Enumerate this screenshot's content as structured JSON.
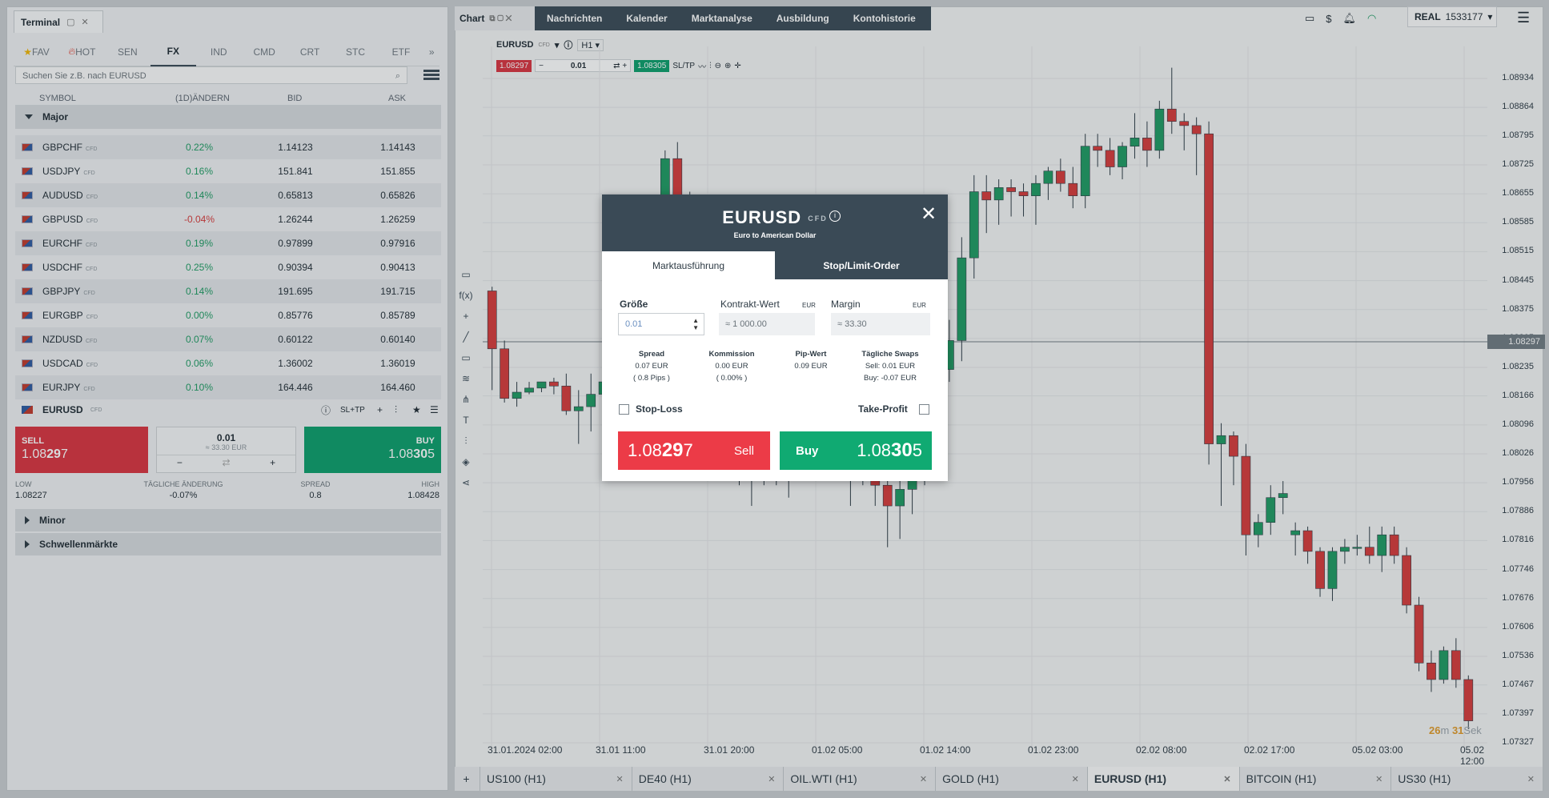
{
  "terminal": {
    "tab_label": "Terminal",
    "categories": [
      "FAV",
      "HOT",
      "SEN",
      "FX",
      "IND",
      "CMD",
      "CRT",
      "STC",
      "ETF"
    ],
    "search_placeholder": "Suchen Sie z.B. nach EURUSD",
    "columns": {
      "symbol": "SYMBOL",
      "change": "(1D)ÄNDERN",
      "bid": "BID",
      "ask": "ASK"
    },
    "group_major": "Major",
    "cfd_tag": "CFD",
    "rows": [
      {
        "symbol": "GBPCHF",
        "change": "0.22%",
        "bid": "1.14123",
        "ask": "1.14143",
        "dir": "pos"
      },
      {
        "symbol": "USDJPY",
        "change": "0.16%",
        "bid": "151.841",
        "ask": "151.855",
        "dir": "pos"
      },
      {
        "symbol": "AUDUSD",
        "change": "0.14%",
        "bid": "0.65813",
        "ask": "0.65826",
        "dir": "pos"
      },
      {
        "symbol": "GBPUSD",
        "change": "-0.04%",
        "bid": "1.26244",
        "ask": "1.26259",
        "dir": "neg"
      },
      {
        "symbol": "EURCHF",
        "change": "0.19%",
        "bid": "0.97899",
        "ask": "0.97916",
        "dir": "pos"
      },
      {
        "symbol": "USDCHF",
        "change": "0.25%",
        "bid": "0.90394",
        "ask": "0.90413",
        "dir": "pos"
      },
      {
        "symbol": "GBPJPY",
        "change": "0.14%",
        "bid": "191.695",
        "ask": "191.715",
        "dir": "pos"
      },
      {
        "symbol": "EURGBP",
        "change": "0.00%",
        "bid": "0.85776",
        "ask": "0.85789",
        "dir": "pos"
      },
      {
        "symbol": "NZDUSD",
        "change": "0.07%",
        "bid": "0.60122",
        "ask": "0.60140",
        "dir": "pos"
      },
      {
        "symbol": "USDCAD",
        "change": "0.06%",
        "bid": "1.36002",
        "ask": "1.36019",
        "dir": "pos"
      },
      {
        "symbol": "EURJPY",
        "change": "0.10%",
        "bid": "164.446",
        "ask": "164.460",
        "dir": "pos"
      }
    ],
    "selected": {
      "symbol": "EURUSD",
      "sltp": "SL+TP",
      "sell_label": "SELL",
      "sell_price_a": "1.08",
      "sell_price_b": "29",
      "sell_price_c": "7",
      "buy_label": "BUY",
      "buy_price_a": "1.08",
      "buy_price_b": "30",
      "buy_price_c": "5",
      "qty": "0.01",
      "qty_eur": "≈ 33.30 EUR",
      "low_label": "LOW",
      "low": "1.08227",
      "daily_label": "TÄGLICHE ÄNDERUNG",
      "daily": "-0.07%",
      "spread_label": "SPREAD",
      "spread": "0.8",
      "high_label": "HIGH",
      "high": "1.08428"
    },
    "group_minor": "Minor",
    "group_emerging": "Schwellenmärkte"
  },
  "nav": {
    "chart_tab": "Chart",
    "items": [
      "Nachrichten",
      "Kalender",
      "Marktanalyse",
      "Ausbildung",
      "Kontohistorie"
    ],
    "account_type": "REAL",
    "account_id": "1533177"
  },
  "chart_toolbar": {
    "symbol": "EURUSD",
    "cfd": "CFD",
    "timeframe": "H1",
    "sell_price": "1.08297",
    "qty": "0.01",
    "buy_price": "1.08305",
    "sltp": "SL/TP"
  },
  "chart_data": {
    "type": "candlestick",
    "symbol": "EURUSD",
    "timeframe": "H1",
    "y_ticks": [
      "1.08934",
      "1.08864",
      "1.08795",
      "1.08725",
      "1.08655",
      "1.08585",
      "1.08515",
      "1.08445",
      "1.08375",
      "1.08305",
      "1.08235",
      "1.08166",
      "1.08096",
      "1.08026",
      "1.07956",
      "1.07886",
      "1.07816",
      "1.07746",
      "1.07676",
      "1.07606",
      "1.07536",
      "1.07467",
      "1.07397",
      "1.07327"
    ],
    "ylim": [
      1.07327,
      1.08934
    ],
    "current_price": "1.08297",
    "x_ticks": [
      "31.01.2024 02:00",
      "31.01 11:00",
      "31.01 20:00",
      "01.02 05:00",
      "01.02 14:00",
      "01.02 23:00",
      "02.02 08:00",
      "02.02 17:00",
      "05.02 03:00",
      "05.02 12:00"
    ],
    "timer": {
      "m": "26",
      "m_unit": "m",
      "s": "31",
      "s_unit": "Sek"
    },
    "colors": {
      "up": "#1e9a62",
      "down": "#d63a3a"
    },
    "candles": [
      [
        1.0842,
        1.0843,
        1.0818,
        1.0828
      ],
      [
        1.0828,
        1.083,
        1.0815,
        1.0816
      ],
      [
        1.0816,
        1.082,
        1.0814,
        1.08175
      ],
      [
        1.08175,
        1.082,
        1.0817,
        1.08185
      ],
      [
        1.08185,
        1.082,
        1.08175,
        1.082
      ],
      [
        1.082,
        1.0821,
        1.0817,
        1.0819
      ],
      [
        1.0819,
        1.0822,
        1.0812,
        1.0813
      ],
      [
        1.0813,
        1.0818,
        1.0805,
        1.0814
      ],
      [
        1.0814,
        1.0822,
        1.0808,
        1.0817
      ],
      [
        1.0817,
        1.083,
        1.0812,
        1.082
      ],
      [
        1.082,
        1.0832,
        1.0818,
        1.0824
      ],
      [
        1.0824,
        1.0828,
        1.081,
        1.0815
      ],
      [
        1.0815,
        1.0828,
        1.08,
        1.0826
      ],
      [
        1.0826,
        1.085,
        1.082,
        1.0845
      ],
      [
        1.0845,
        1.0876,
        1.084,
        1.0874
      ],
      [
        1.0874,
        1.0878,
        1.086,
        1.0862
      ],
      [
        1.0862,
        1.0866,
        1.085,
        1.0854
      ],
      [
        1.0854,
        1.0858,
        1.083,
        1.0835
      ],
      [
        1.0835,
        1.084,
        1.082,
        1.0825
      ],
      [
        1.0825,
        1.083,
        1.081,
        1.0815
      ],
      [
        1.0815,
        1.082,
        1.0795,
        1.0799
      ],
      [
        1.0799,
        1.0805,
        1.079,
        1.0798
      ],
      [
        1.0798,
        1.081,
        1.0795,
        1.0805
      ],
      [
        1.0805,
        1.0815,
        1.0795,
        1.0799
      ],
      [
        1.0799,
        1.0812,
        1.0792,
        1.081
      ],
      [
        1.081,
        1.082,
        1.0799,
        1.0815
      ],
      [
        1.0815,
        1.083,
        1.081,
        1.0825
      ],
      [
        1.0825,
        1.083,
        1.0805,
        1.0815
      ],
      [
        1.0815,
        1.082,
        1.08,
        1.0805
      ],
      [
        1.0805,
        1.081,
        1.079,
        1.08
      ],
      [
        1.08,
        1.081,
        1.0795,
        1.0805
      ],
      [
        1.0805,
        1.081,
        1.079,
        1.0795
      ],
      [
        1.0795,
        1.08,
        1.078,
        1.079
      ],
      [
        1.079,
        1.0798,
        1.0782,
        1.0794
      ],
      [
        1.0794,
        1.0805,
        1.0788,
        1.08
      ],
      [
        1.08,
        1.081,
        1.0795,
        1.0808
      ],
      [
        1.0808,
        1.0825,
        1.0805,
        1.0823
      ],
      [
        1.0823,
        1.0835,
        1.082,
        1.083
      ],
      [
        1.083,
        1.0855,
        1.0825,
        1.085
      ],
      [
        1.085,
        1.087,
        1.0845,
        1.0866
      ],
      [
        1.0866,
        1.087,
        1.0856,
        1.0864
      ],
      [
        1.0864,
        1.0869,
        1.0858,
        1.0867
      ],
      [
        1.0867,
        1.0869,
        1.086,
        1.0866
      ],
      [
        1.0866,
        1.0868,
        1.086,
        1.0865
      ],
      [
        1.0865,
        1.087,
        1.0858,
        1.0868
      ],
      [
        1.0868,
        1.0872,
        1.0864,
        1.0871
      ],
      [
        1.0871,
        1.0874,
        1.0866,
        1.0868
      ],
      [
        1.0868,
        1.0872,
        1.0862,
        1.0865
      ],
      [
        1.0865,
        1.088,
        1.0862,
        1.0877
      ],
      [
        1.0877,
        1.088,
        1.0872,
        1.0876
      ],
      [
        1.0876,
        1.0879,
        1.087,
        1.0872
      ],
      [
        1.0872,
        1.0878,
        1.0869,
        1.0877
      ],
      [
        1.0877,
        1.0885,
        1.0874,
        1.0879
      ],
      [
        1.0879,
        1.0883,
        1.0872,
        1.0876
      ],
      [
        1.0876,
        1.0888,
        1.0874,
        1.0886
      ],
      [
        1.0886,
        1.0896,
        1.088,
        1.0883
      ],
      [
        1.0883,
        1.0885,
        1.0876,
        1.0882
      ],
      [
        1.0882,
        1.0884,
        1.087,
        1.088
      ],
      [
        1.088,
        1.0883,
        1.08,
        1.0805
      ],
      [
        1.0805,
        1.081,
        1.079,
        1.0807
      ],
      [
        1.0807,
        1.0808,
        1.0795,
        1.0802
      ],
      [
        1.0802,
        1.0805,
        1.0778,
        1.0783
      ],
      [
        1.0783,
        1.0788,
        1.078,
        1.0786
      ],
      [
        1.0786,
        1.0795,
        1.0783,
        1.0792
      ],
      [
        1.0792,
        1.0796,
        1.0788,
        1.0793
      ],
      [
        1.0783,
        1.0786,
        1.0778,
        1.0784
      ],
      [
        1.0784,
        1.0785,
        1.0776,
        1.0779
      ],
      [
        1.0779,
        1.078,
        1.0768,
        1.077
      ],
      [
        1.077,
        1.078,
        1.0767,
        1.0779
      ],
      [
        1.0779,
        1.0782,
        1.0776,
        1.078
      ],
      [
        1.078,
        1.0783,
        1.0778,
        1.078
      ],
      [
        1.078,
        1.0785,
        1.0776,
        1.0778
      ],
      [
        1.0778,
        1.0785,
        1.0774,
        1.0783
      ],
      [
        1.0783,
        1.0785,
        1.0776,
        1.0778
      ],
      [
        1.0778,
        1.078,
        1.0764,
        1.0766
      ],
      [
        1.0766,
        1.0768,
        1.075,
        1.0752
      ],
      [
        1.0752,
        1.0755,
        1.0745,
        1.0748
      ],
      [
        1.0748,
        1.0756,
        1.0747,
        1.0755
      ],
      [
        1.0755,
        1.0758,
        1.0746,
        1.0748
      ],
      [
        1.0748,
        1.0749,
        1.0736,
        1.0738
      ]
    ]
  },
  "bottom_tabs": [
    "US100 (H1)",
    "DE40 (H1)",
    "OIL.WTI (H1)",
    "GOLD (H1)",
    "EURUSD (H1)",
    "BITCOIN (H1)",
    "US30 (H1)"
  ],
  "modal": {
    "symbol": "EURUSD",
    "cfd": "CFD",
    "subtitle": "Euro to American Dollar",
    "tab_market": "Marktausführung",
    "tab_limit": "Stop/Limit-Order",
    "size_label": "Größe",
    "size_value": "0.01",
    "contract_label": "Kontrakt-Wert",
    "contract_cur": "EUR",
    "contract_value": "≈ 1 000.00",
    "margin_label": "Margin",
    "margin_cur": "EUR",
    "margin_value": "≈ 33.30",
    "spread_label": "Spread",
    "spread_1": "0.07 EUR",
    "spread_2": "( 0.8 Pips )",
    "commission_label": "Kommission",
    "commission_1": "0.00 EUR",
    "commission_2": "( 0.00% )",
    "pip_label": "Pip-Wert",
    "pip_value": "0.09 EUR",
    "swap_label": "Tägliche Swaps",
    "swap_sell": "Sell: 0.01 EUR",
    "swap_buy": "Buy: -0.07 EUR",
    "stop_loss": "Stop-Loss",
    "take_profit": "Take-Profit",
    "sell_label": "Sell",
    "sell_a": "1.08",
    "sell_b": "29",
    "sell_c": "7",
    "buy_label": "Buy",
    "buy_a": "1.08",
    "buy_b": "30",
    "buy_c": "5"
  }
}
